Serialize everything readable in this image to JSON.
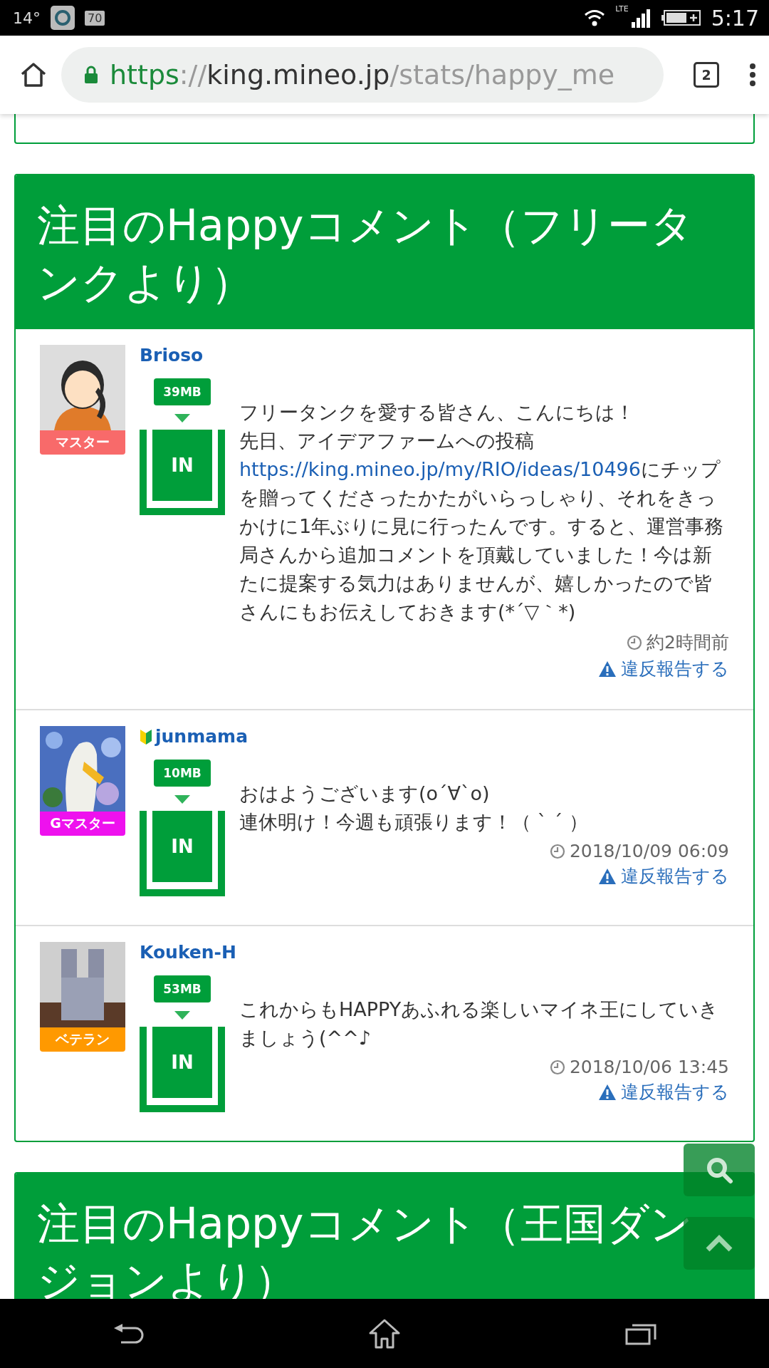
{
  "status_bar": {
    "temperature": "14°",
    "notification_badge": "70",
    "network": "LTE",
    "time": "5:17"
  },
  "browser": {
    "url": {
      "scheme": "https",
      "separator": "://",
      "host": "king.mineo.jp",
      "path": "/stats/happy_me"
    },
    "tab_count": "2"
  },
  "sections": [
    {
      "title": "注目のHappyコメント（フリータンクより）",
      "comments": [
        {
          "user": "Brioso",
          "beginner": false,
          "rank": "マスター",
          "color": "#f86a6a",
          "data": "39MB",
          "gate": "IN",
          "lines": [
            [
              {
                "kind": "text",
                "text": "フリータンクを愛する皆さん、こんにちは！"
              }
            ],
            [
              {
                "kind": "text",
                "text": "先日、アイデアファームへの投稿"
              },
              {
                "kind": "link",
                "text": "https://king.mineo.jp/my/RIO/ideas/10496"
              },
              {
                "kind": "text",
                "text": "にチップを贈ってくださったかたがいらっしゃり、それをきっかけに1年ぶりに見に行ったんです。すると、運営事務局さんから追加コメントを頂戴していました！今は新たに提案する気力はありませんが、嬉しかったので皆さんにもお伝えしておきます(*´▽｀*)"
              }
            ]
          ],
          "time": "約2時間前",
          "report": "違反報告する"
        },
        {
          "user": "junmama",
          "beginner": true,
          "rank": "Gマスター",
          "color": "#ee11ee",
          "data": "10MB",
          "gate": "IN",
          "lines": [
            [
              {
                "kind": "text",
                "text": "おはようございます(o´∀`o)"
              }
            ],
            [
              {
                "kind": "text",
                "text": "連休明け！今週も頑張ります！（ ` ´ ）"
              }
            ]
          ],
          "time": "2018/10/09 06:09",
          "report": "違反報告する"
        },
        {
          "user": "Kouken-H",
          "beginner": false,
          "rank": "ベテラン",
          "color": "#ff9900",
          "data": "53MB",
          "gate": "IN",
          "lines": [
            [
              {
                "kind": "text",
                "text": "これからもHAPPYあふれる楽しいマイネ王にしていきましょう(^^♪"
              }
            ]
          ],
          "time": "2018/10/06 13:45",
          "report": "違反報告する"
        }
      ]
    },
    {
      "title": "注目のHappyコメント（王国ダンジョンより）"
    }
  ]
}
